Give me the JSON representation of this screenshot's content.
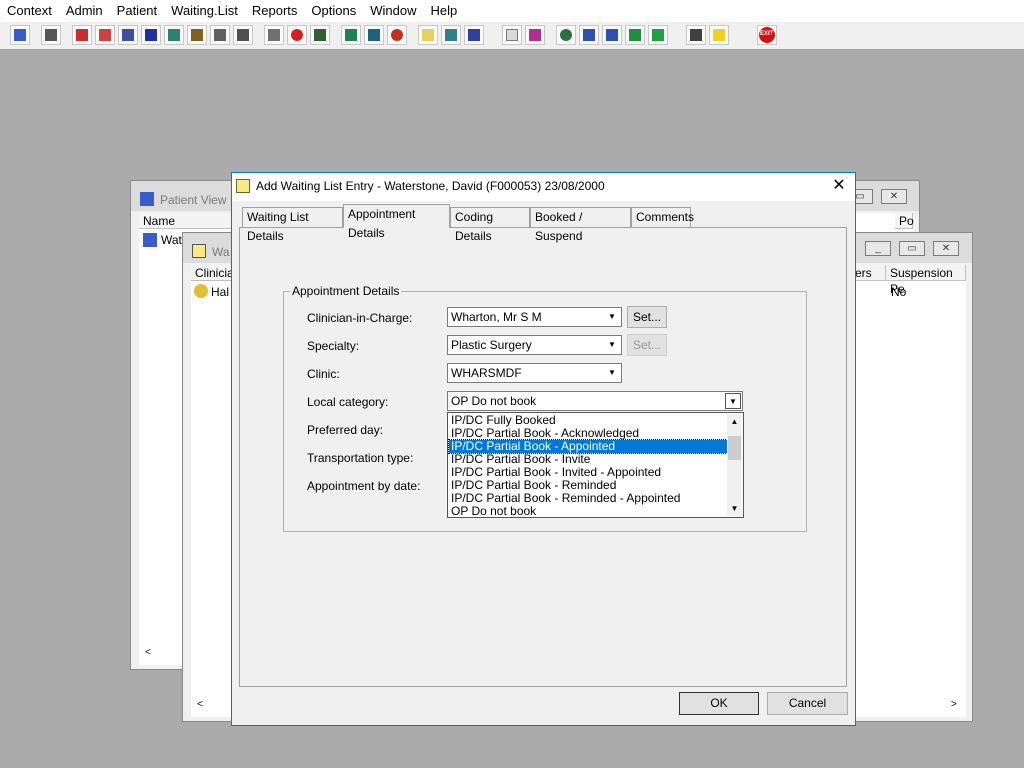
{
  "menu": [
    "Context",
    "Admin",
    "Patient",
    "Waiting.List",
    "Reports",
    "Options",
    "Window",
    "Help"
  ],
  "bg_window1": {
    "title": "Patient View :",
    "col_name": "Name",
    "col_po": "Po",
    "row_text": "Wate"
  },
  "bg_window2": {
    "title": "Wa",
    "col_clinician": "Clinicia",
    "col_ers": "ers",
    "col_suspension": "Suspension Pe",
    "row_text": "Hal",
    "row_no": "No"
  },
  "dialog": {
    "title": "Add Waiting List Entry - Waterstone, David (F000053) 23/08/2000",
    "close_glyph": "✕",
    "tabs": [
      "Waiting List Details",
      "Appointment Details",
      "Coding Details",
      "Booked / Suspend",
      "Comments"
    ],
    "group_title": "Appointment Details",
    "fields": {
      "clinician_label": "Clinician-in-Charge:",
      "clinician_value": "Wharton, Mr S M",
      "specialty_label": "Specialty:",
      "specialty_value": "Plastic Surgery",
      "clinic_label": "Clinic:",
      "clinic_value": "WHARSMDF",
      "local_category_label": "Local category:",
      "local_category_value": "OP Do not book",
      "preferred_day_label": "Preferred day:",
      "transportation_label": "Transportation type:",
      "appointment_by_label": "Appointment by date:"
    },
    "set_label": "Set...",
    "dropdown_options": [
      "IP/DC Fully Booked",
      "IP/DC Partial Book - Acknowledged",
      "IP/DC Partial Book - Appointed",
      "IP/DC Partial Book - Invite",
      "IP/DC Partial Book - Invited - Appointed",
      "IP/DC Partial Book - Reminded",
      "IP/DC Partial Book - Reminded - Appointed",
      "OP Do not book"
    ],
    "ok_label": "OK",
    "cancel_label": "Cancel"
  },
  "icons": {
    "exit_label": "EXIT"
  },
  "colors": {
    "selection": "#0078d7",
    "accent_border": "#0078d7",
    "desktop": "#ababab"
  }
}
